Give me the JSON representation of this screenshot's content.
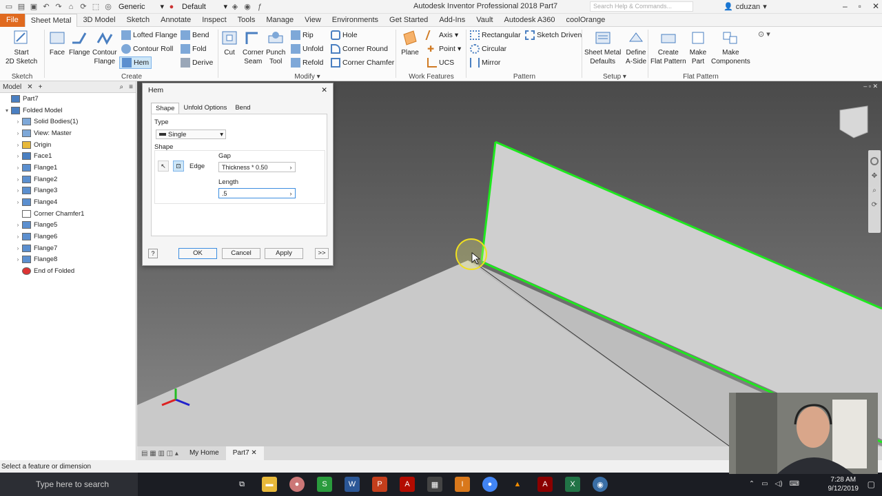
{
  "titlebar": {
    "preset": "Generic",
    "appearance": "Default",
    "app_title": "Autodesk Inventor Professional 2018   Part7",
    "search_placeholder": "Search Help & Commands...",
    "user": "cduzan"
  },
  "tabs": [
    "File",
    "Sheet Metal",
    "3D Model",
    "Sketch",
    "Annotate",
    "Inspect",
    "Tools",
    "Manage",
    "View",
    "Environments",
    "Get Started",
    "Add-Ins",
    "Vault",
    "Autodesk A360",
    "coolOrange"
  ],
  "ribbon": {
    "sketch": {
      "title": "Sketch",
      "start": "Start",
      "sketch2d": "2D Sketch"
    },
    "create": {
      "title": "Create",
      "face": "Face",
      "flange": "Flange",
      "contour": "Contour",
      "contour_flange": "Flange",
      "lofted_flange": "Lofted Flange",
      "contour_roll": "Contour Roll",
      "hem": "Hem",
      "bend": "Bend",
      "fold": "Fold",
      "derive": "Derive"
    },
    "modify": {
      "title": "Modify",
      "cut": "Cut",
      "corner": "Corner",
      "seam": "Seam",
      "punch": "Punch",
      "tool": "Tool",
      "rip": "Rip",
      "unfold": "Unfold",
      "refold": "Refold",
      "hole": "Hole",
      "corner_round": "Corner Round",
      "corner_chamfer": "Corner Chamfer"
    },
    "work": {
      "title": "Work Features",
      "plane": "Plane",
      "axis": "Axis",
      "point": "Point",
      "ucs": "UCS"
    },
    "pattern": {
      "title": "Pattern",
      "rectangular": "Rectangular",
      "circular": "Circular",
      "mirror": "Mirror",
      "sketch_driven": "Sketch Driven"
    },
    "setup": {
      "title": "Setup",
      "sheet_metal": "Sheet Metal",
      "defaults": "Defaults",
      "define": "Define",
      "aside": "A-Side"
    },
    "flat": {
      "title": "Flat Pattern",
      "create": "Create",
      "flat_pattern": "Flat Pattern",
      "make": "Make",
      "part": "Part",
      "make2": "Make",
      "components": "Components"
    }
  },
  "browser": {
    "tab": "Model",
    "items": [
      {
        "label": "Part7",
        "level": 0,
        "expand": ""
      },
      {
        "label": "Folded Model",
        "level": 0,
        "expand": "▾"
      },
      {
        "label": "Solid Bodies(1)",
        "level": 1,
        "expand": "›"
      },
      {
        "label": "View: Master",
        "level": 1,
        "expand": "›"
      },
      {
        "label": "Origin",
        "level": 1,
        "expand": "›"
      },
      {
        "label": "Face1",
        "level": 1,
        "expand": "›"
      },
      {
        "label": "Flange1",
        "level": 1,
        "expand": "›"
      },
      {
        "label": "Flange2",
        "level": 1,
        "expand": "›"
      },
      {
        "label": "Flange3",
        "level": 1,
        "expand": "›"
      },
      {
        "label": "Flange4",
        "level": 1,
        "expand": "›"
      },
      {
        "label": "Corner Chamfer1",
        "level": 1,
        "expand": ""
      },
      {
        "label": "Flange5",
        "level": 1,
        "expand": "›"
      },
      {
        "label": "Flange6",
        "level": 1,
        "expand": "›"
      },
      {
        "label": "Flange7",
        "level": 1,
        "expand": "›"
      },
      {
        "label": "Flange8",
        "level": 1,
        "expand": "›"
      },
      {
        "label": "End of Folded",
        "level": 1,
        "expand": ""
      }
    ]
  },
  "dialog": {
    "title": "Hem",
    "tabs": [
      "Shape",
      "Unfold Options",
      "Bend"
    ],
    "type_label": "Type",
    "type_value": "Single",
    "shape_label": "Shape",
    "edge_label": "Edge",
    "gap_label": "Gap",
    "gap_value": "Thickness * 0.50",
    "length_label": "Length",
    "length_value": ".5",
    "ok": "OK",
    "cancel": "Cancel",
    "apply": "Apply",
    "more": ">>"
  },
  "doc_tabs": [
    "My Home",
    "Part7"
  ],
  "status": "Select a feature or dimension",
  "taskbar": {
    "search": "Type here to search",
    "time": "7:28 AM",
    "date": "9/12/2019"
  },
  "colors": {
    "accent": "#e06a1f",
    "highlight_edge": "#1ee81e",
    "selection": "#cde6f7"
  }
}
